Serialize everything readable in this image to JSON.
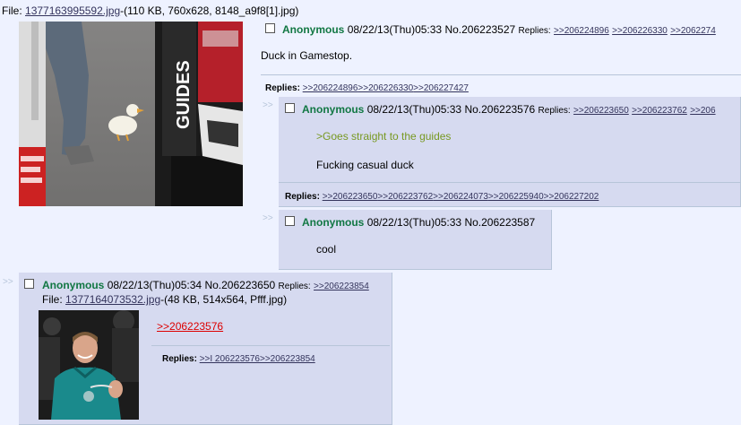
{
  "op": {
    "file_prefix": "File: ",
    "file_name": "1377163995592.jpg",
    "file_info": "-(110 KB, 760x628, 8148_a9f8[1].jpg)",
    "name": "Anonymous",
    "datetime": "08/22/13(Thu)05:33",
    "number": "No.206223527",
    "replies_prefix": "Replies:",
    "reply_links": [
      ">>206224896",
      ">>206226330",
      ">>2062274"
    ],
    "message": "Duck in Gamestop.",
    "footer_label": "Replies:",
    "footer_links": [
      ">>206224896",
      ">>206226330",
      ">>206227427"
    ],
    "image_text": {
      "guides": "GUIDES"
    }
  },
  "reply1": {
    "arrow": ">>",
    "name": "Anonymous",
    "datetime": "08/22/13(Thu)05:33",
    "number": "No.206223576",
    "replies_prefix": "Replies:",
    "reply_links": [
      ">>206223650",
      ">>206223762",
      ">>206"
    ],
    "greentext": ">Goes straight to the guides",
    "message": "Fucking casual duck",
    "footer_label": "Replies:",
    "footer_links": [
      ">>206223650",
      ">>206223762",
      ">>206224073",
      ">>206225940",
      ">>206227202"
    ]
  },
  "reply2": {
    "arrow": ">>",
    "name": "Anonymous",
    "datetime": "08/22/13(Thu)05:33",
    "number": "No.206223587",
    "message": "cool"
  },
  "reply3": {
    "arrow": ">>",
    "name": "Anonymous",
    "datetime": "08/22/13(Thu)05:34",
    "number": "No.206223650",
    "replies_prefix": "Replies:",
    "reply_links": [
      ">>206223854"
    ],
    "file_prefix": "File: ",
    "file_name": "1377164073532.jpg",
    "file_info": "-(48 KB, 514x564, Pfff.jpg)",
    "quote": ">>206223576",
    "footer_label": "Replies:",
    "footer_links": [
      ">>I 206223576",
      ">>206223854"
    ]
  },
  "colors": {
    "background": "#eef2ff",
    "reply_bg": "#d6daf0",
    "name_green": "#117743",
    "greentext": "#789922",
    "quote_red": "#dd0000",
    "link": "#34345c"
  },
  "icons": [
    "checkbox-icon"
  ]
}
